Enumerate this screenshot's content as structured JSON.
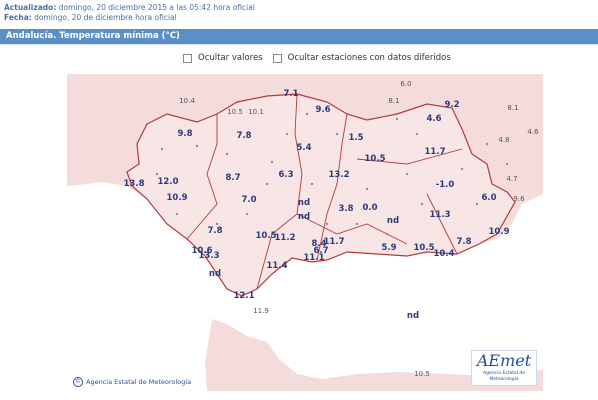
{
  "header": {
    "updated_label": "Actualizado:",
    "updated_value": "domingo, 20 diciembre 2015 a las 05:42 hora oficial",
    "date_label": "Fecha:",
    "date_value": "domingo, 20 de diciembre hora oficial"
  },
  "title": "Andalucía. Temperatura mínima (°C)",
  "options": {
    "hide_values": "Ocultar valores",
    "hide_stations": "Ocultar estaciones con datos diferidos"
  },
  "map": {
    "colors": {
      "land": "#f4dcdc",
      "sea": "#ffffff",
      "border": "#b23a3a",
      "value": "#2b3a7a"
    },
    "stations": [
      {
        "id": "s1",
        "value": "7.1",
        "small": false
      },
      {
        "id": "s2",
        "value": "6.0",
        "small": true
      },
      {
        "id": "s3",
        "value": "10.4",
        "small": true
      },
      {
        "id": "s4",
        "value": "10.5",
        "small": true
      },
      {
        "id": "s5",
        "value": "10.1",
        "small": true
      },
      {
        "id": "s6",
        "value": "9.6",
        "small": false
      },
      {
        "id": "s7",
        "value": "8.1",
        "small": true
      },
      {
        "id": "s8",
        "value": "9.2",
        "small": false
      },
      {
        "id": "s9",
        "value": "8.1",
        "small": true
      },
      {
        "id": "s10",
        "value": "4.6",
        "small": false
      },
      {
        "id": "s11",
        "value": "4.6",
        "small": true
      },
      {
        "id": "s12",
        "value": "4.8",
        "small": true
      },
      {
        "id": "s13",
        "value": "9.8",
        "small": false
      },
      {
        "id": "s14",
        "value": "7.8",
        "small": false
      },
      {
        "id": "s15",
        "value": "1.5",
        "small": false
      },
      {
        "id": "s16",
        "value": "5.4",
        "small": false
      },
      {
        "id": "s17",
        "value": "10.5",
        "small": false
      },
      {
        "id": "s18",
        "value": "11.7",
        "small": false
      },
      {
        "id": "s19",
        "value": "4.7",
        "small": true
      },
      {
        "id": "s20",
        "value": "13.8",
        "small": false
      },
      {
        "id": "s21",
        "value": "12.0",
        "small": false
      },
      {
        "id": "s22",
        "value": "8.7",
        "small": false
      },
      {
        "id": "s23",
        "value": "6.3",
        "small": false
      },
      {
        "id": "s24",
        "value": "13.2",
        "small": false
      },
      {
        "id": "s25",
        "value": "-1.0",
        "small": false
      },
      {
        "id": "s26",
        "value": "10.9",
        "small": false
      },
      {
        "id": "s27",
        "value": "7.0",
        "small": false
      },
      {
        "id": "s28",
        "value": "nd",
        "small": false
      },
      {
        "id": "s29",
        "value": "nd",
        "small": false
      },
      {
        "id": "s30",
        "value": "3.8",
        "small": false
      },
      {
        "id": "s31",
        "value": "0.0",
        "small": false
      },
      {
        "id": "s32",
        "value": "nd",
        "small": false
      },
      {
        "id": "s33",
        "value": "11.3",
        "small": false
      },
      {
        "id": "s34",
        "value": "6.0",
        "small": false
      },
      {
        "id": "s35",
        "value": "9.6",
        "small": true
      },
      {
        "id": "s36",
        "value": "7.8",
        "small": false
      },
      {
        "id": "s37",
        "value": "10.5",
        "small": false
      },
      {
        "id": "s38",
        "value": "11.2",
        "small": false
      },
      {
        "id": "s39",
        "value": "8.4",
        "small": false
      },
      {
        "id": "s40",
        "value": "11.7",
        "small": false
      },
      {
        "id": "s41",
        "value": "10.9",
        "small": false
      },
      {
        "id": "s42",
        "value": "10.6",
        "small": false
      },
      {
        "id": "s43",
        "value": "13.3",
        "small": false
      },
      {
        "id": "s44",
        "value": "6.7",
        "small": false
      },
      {
        "id": "s45",
        "value": "11.1",
        "small": false
      },
      {
        "id": "s46",
        "value": "5.9",
        "small": false
      },
      {
        "id": "s47",
        "value": "10.5",
        "small": false
      },
      {
        "id": "s48",
        "value": "7.8",
        "small": false
      },
      {
        "id": "s49",
        "value": "10.4",
        "small": false
      },
      {
        "id": "s50",
        "value": "11.4",
        "small": false
      },
      {
        "id": "s51",
        "value": "nd",
        "small": false
      },
      {
        "id": "s52",
        "value": "12.1",
        "small": false
      },
      {
        "id": "s53",
        "value": "11.9",
        "small": true
      },
      {
        "id": "s54",
        "value": "nd",
        "small": false
      },
      {
        "id": "s55",
        "value": "10.5",
        "small": true
      }
    ]
  },
  "credit": "Agencia Estatal de Meteorología",
  "logo": {
    "mark": "AEmet",
    "sub": "Agencia Estatal de Meteorología"
  }
}
